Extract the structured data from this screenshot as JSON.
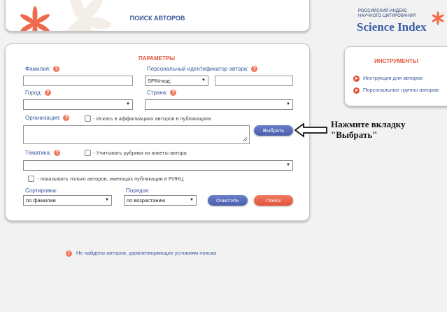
{
  "header": {
    "title": "ПОИСК АВТОРОВ"
  },
  "logo": {
    "line1": "РОССИЙСКИЙ ИНДЕКС",
    "line2": "НАУЧНОГО ЦИТИРОВАНИЯ",
    "brand": "Science Index"
  },
  "params": {
    "title": "ПАРАМЕТРЫ",
    "surname_label": "Фамилия:",
    "author_id_label": "Персональный идентификатор автора:",
    "id_type_value": "SPIN-код:",
    "city_label": "Город:",
    "country_label": "Страна:",
    "org_label": "Организация:",
    "affil_checkbox_label": "- Искать в аффилиациях авторов в публикациях",
    "select_button": "Выбрать",
    "topic_label": "Тематика:",
    "topic_checkbox_label": "- Учитывать рубрики из анкеты автора",
    "rinc_checkbox_label": "- показывать только авторов, имеющих публикации в РИНЦ",
    "sort_label": "Сортировка:",
    "sort_value": "по фамилии",
    "order_label": "Порядок:",
    "order_value": "по возрастанию",
    "clear_button": "Очистить",
    "search_button": "Поиск"
  },
  "tools": {
    "title": "ИНСТРУМЕНТЫ",
    "items": [
      {
        "label": "Инструкция для авторов",
        "icon": "play-icon"
      },
      {
        "label": "Персональные группы авторов",
        "icon": "play-icon"
      }
    ]
  },
  "annotation": {
    "line1": "Нажмите вкладку",
    "line2": "\"Выбрать\""
  },
  "status": {
    "not_found": "Не найдено авторов, удовлетворяющих условиям поиска"
  },
  "colors": {
    "accent_red": "#e0553a",
    "accent_blue": "#3a5a9c",
    "button_blue": "#5568b8"
  }
}
